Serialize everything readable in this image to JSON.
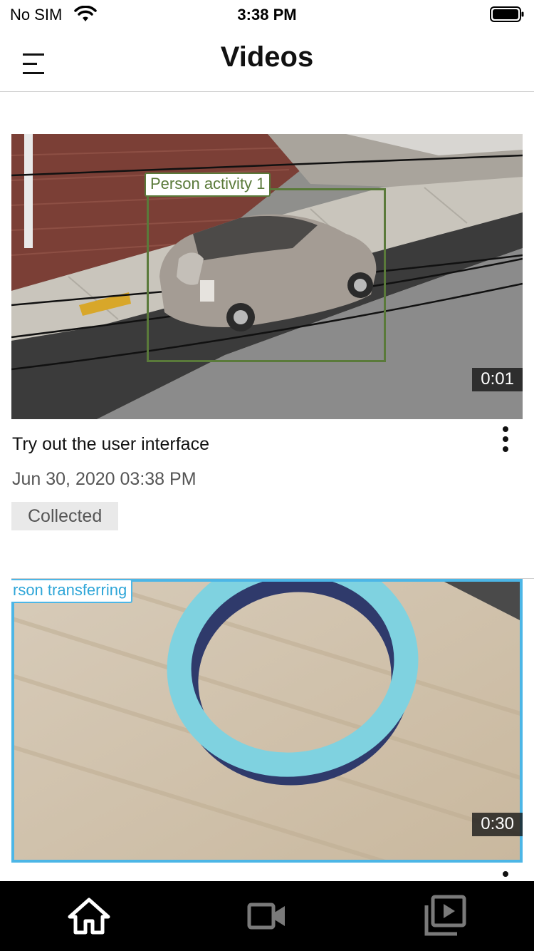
{
  "status_bar": {
    "carrier": "No SIM",
    "time": "3:38 PM",
    "icons": [
      "wifi-icon",
      "battery-icon"
    ]
  },
  "header": {
    "title": "Videos",
    "menu_icon": "menu-icon"
  },
  "videos": [
    {
      "title": "Try out the user interface",
      "date": "Jun 30, 2020 03:38 PM",
      "status": "Collected",
      "duration": "0:01",
      "detection_label": "Person activity 1",
      "detection_color": "#5a7a3a",
      "more_icon": "more-vertical-icon"
    },
    {
      "duration": "0:30",
      "detection_label": "rson transferring",
      "detection_color": "#4cb6e6",
      "more_icon": "more-vertical-icon"
    }
  ],
  "tab_bar": {
    "background": "#000000",
    "tabs": [
      {
        "icon": "home-icon",
        "active": true
      },
      {
        "icon": "video-camera-icon",
        "active": false
      },
      {
        "icon": "video-library-icon",
        "active": false
      }
    ]
  }
}
